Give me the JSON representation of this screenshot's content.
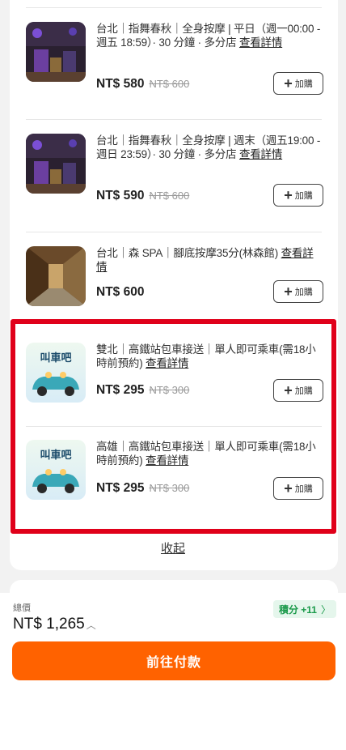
{
  "items": [
    {
      "title": "台北｜指舞春秋｜全身按摩 | 平日（週一00:00 - 週五 18:59）· 30 分鐘 · 多分店 ",
      "more_label": "查看詳情",
      "price": "NT$ 580",
      "original_price": "NT$ 600",
      "add_label": "加購",
      "thumb_icon": "massage-room-photo"
    },
    {
      "title": "台北｜指舞春秋｜全身按摩 | 週末（週五19:00 - 週日 23:59）· 30 分鐘 · 多分店 ",
      "more_label": "查看詳情",
      "price": "NT$ 590",
      "original_price": "NT$ 600",
      "add_label": "加購",
      "thumb_icon": "massage-room-photo"
    },
    {
      "title": "台北｜森 SPA｜腳底按摩35分(林森館) ",
      "more_label": "查看詳情",
      "price": "NT$ 600",
      "original_price": "",
      "add_label": "加購",
      "thumb_icon": "spa-corridor-photo"
    },
    {
      "title": "雙北｜高鐵站包車接送｜單人即可乘車(需18小時前預約) ",
      "more_label": "查看詳情",
      "price": "NT$ 295",
      "original_price": "NT$ 300",
      "add_label": "加購",
      "thumb_icon": "taxi-logo",
      "logo_text": "叫車吧"
    },
    {
      "title": "高雄｜高鐵站包車接送｜單人即可乘車(需18小時前預約) ",
      "more_label": "查看詳情",
      "price": "NT$ 295",
      "original_price": "NT$ 300",
      "add_label": "加購",
      "thumb_icon": "taxi-logo",
      "logo_text": "叫車吧"
    }
  ],
  "collapse_label": "收起",
  "footer": {
    "total_label": "總價",
    "total_value": "NT$ 1,265",
    "points_label": "積分 +11",
    "pay_label": "前往付款"
  },
  "colors": {
    "accent": "#ff6200",
    "highlight": "#e0001a",
    "points_green": "#1a9a4a"
  }
}
